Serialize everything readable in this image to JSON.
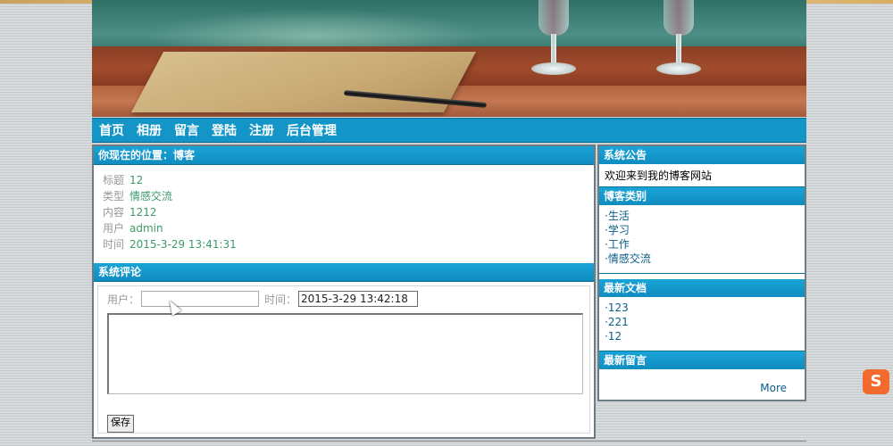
{
  "nav": {
    "items": [
      "首页",
      "相册",
      "留言",
      "登陆",
      "注册",
      "后台管理"
    ]
  },
  "main": {
    "location_title": "你现在的位置：博客",
    "details": [
      {
        "label": "标题",
        "value": "12"
      },
      {
        "label": "类型",
        "value": "情感交流"
      },
      {
        "label": "内容",
        "value": "1212"
      },
      {
        "label": "用户",
        "value": "admin"
      },
      {
        "label": "时间",
        "value": "2015-3-29 13:41:31"
      }
    ],
    "comment_title": "系统评论",
    "user_label": "用户：",
    "user_value": "",
    "time_label": "时间：",
    "time_value": "2015-3-29 13:42:18",
    "save_label": "保存"
  },
  "sidebar": {
    "notice_title": "系统公告",
    "notice_text": "欢迎来到我的博客网站",
    "category_title": "博客类别",
    "categories": [
      "·生活",
      "·学习",
      "·工作",
      "·情感交流"
    ],
    "latest_docs_title": "最新文档",
    "latest_docs": [
      "·123",
      "·221",
      "·12"
    ],
    "latest_msgs_title": "最新留言",
    "more_label": "More"
  },
  "colors": {
    "accent": "#1395c8",
    "value_green": "#3e9a6a"
  }
}
